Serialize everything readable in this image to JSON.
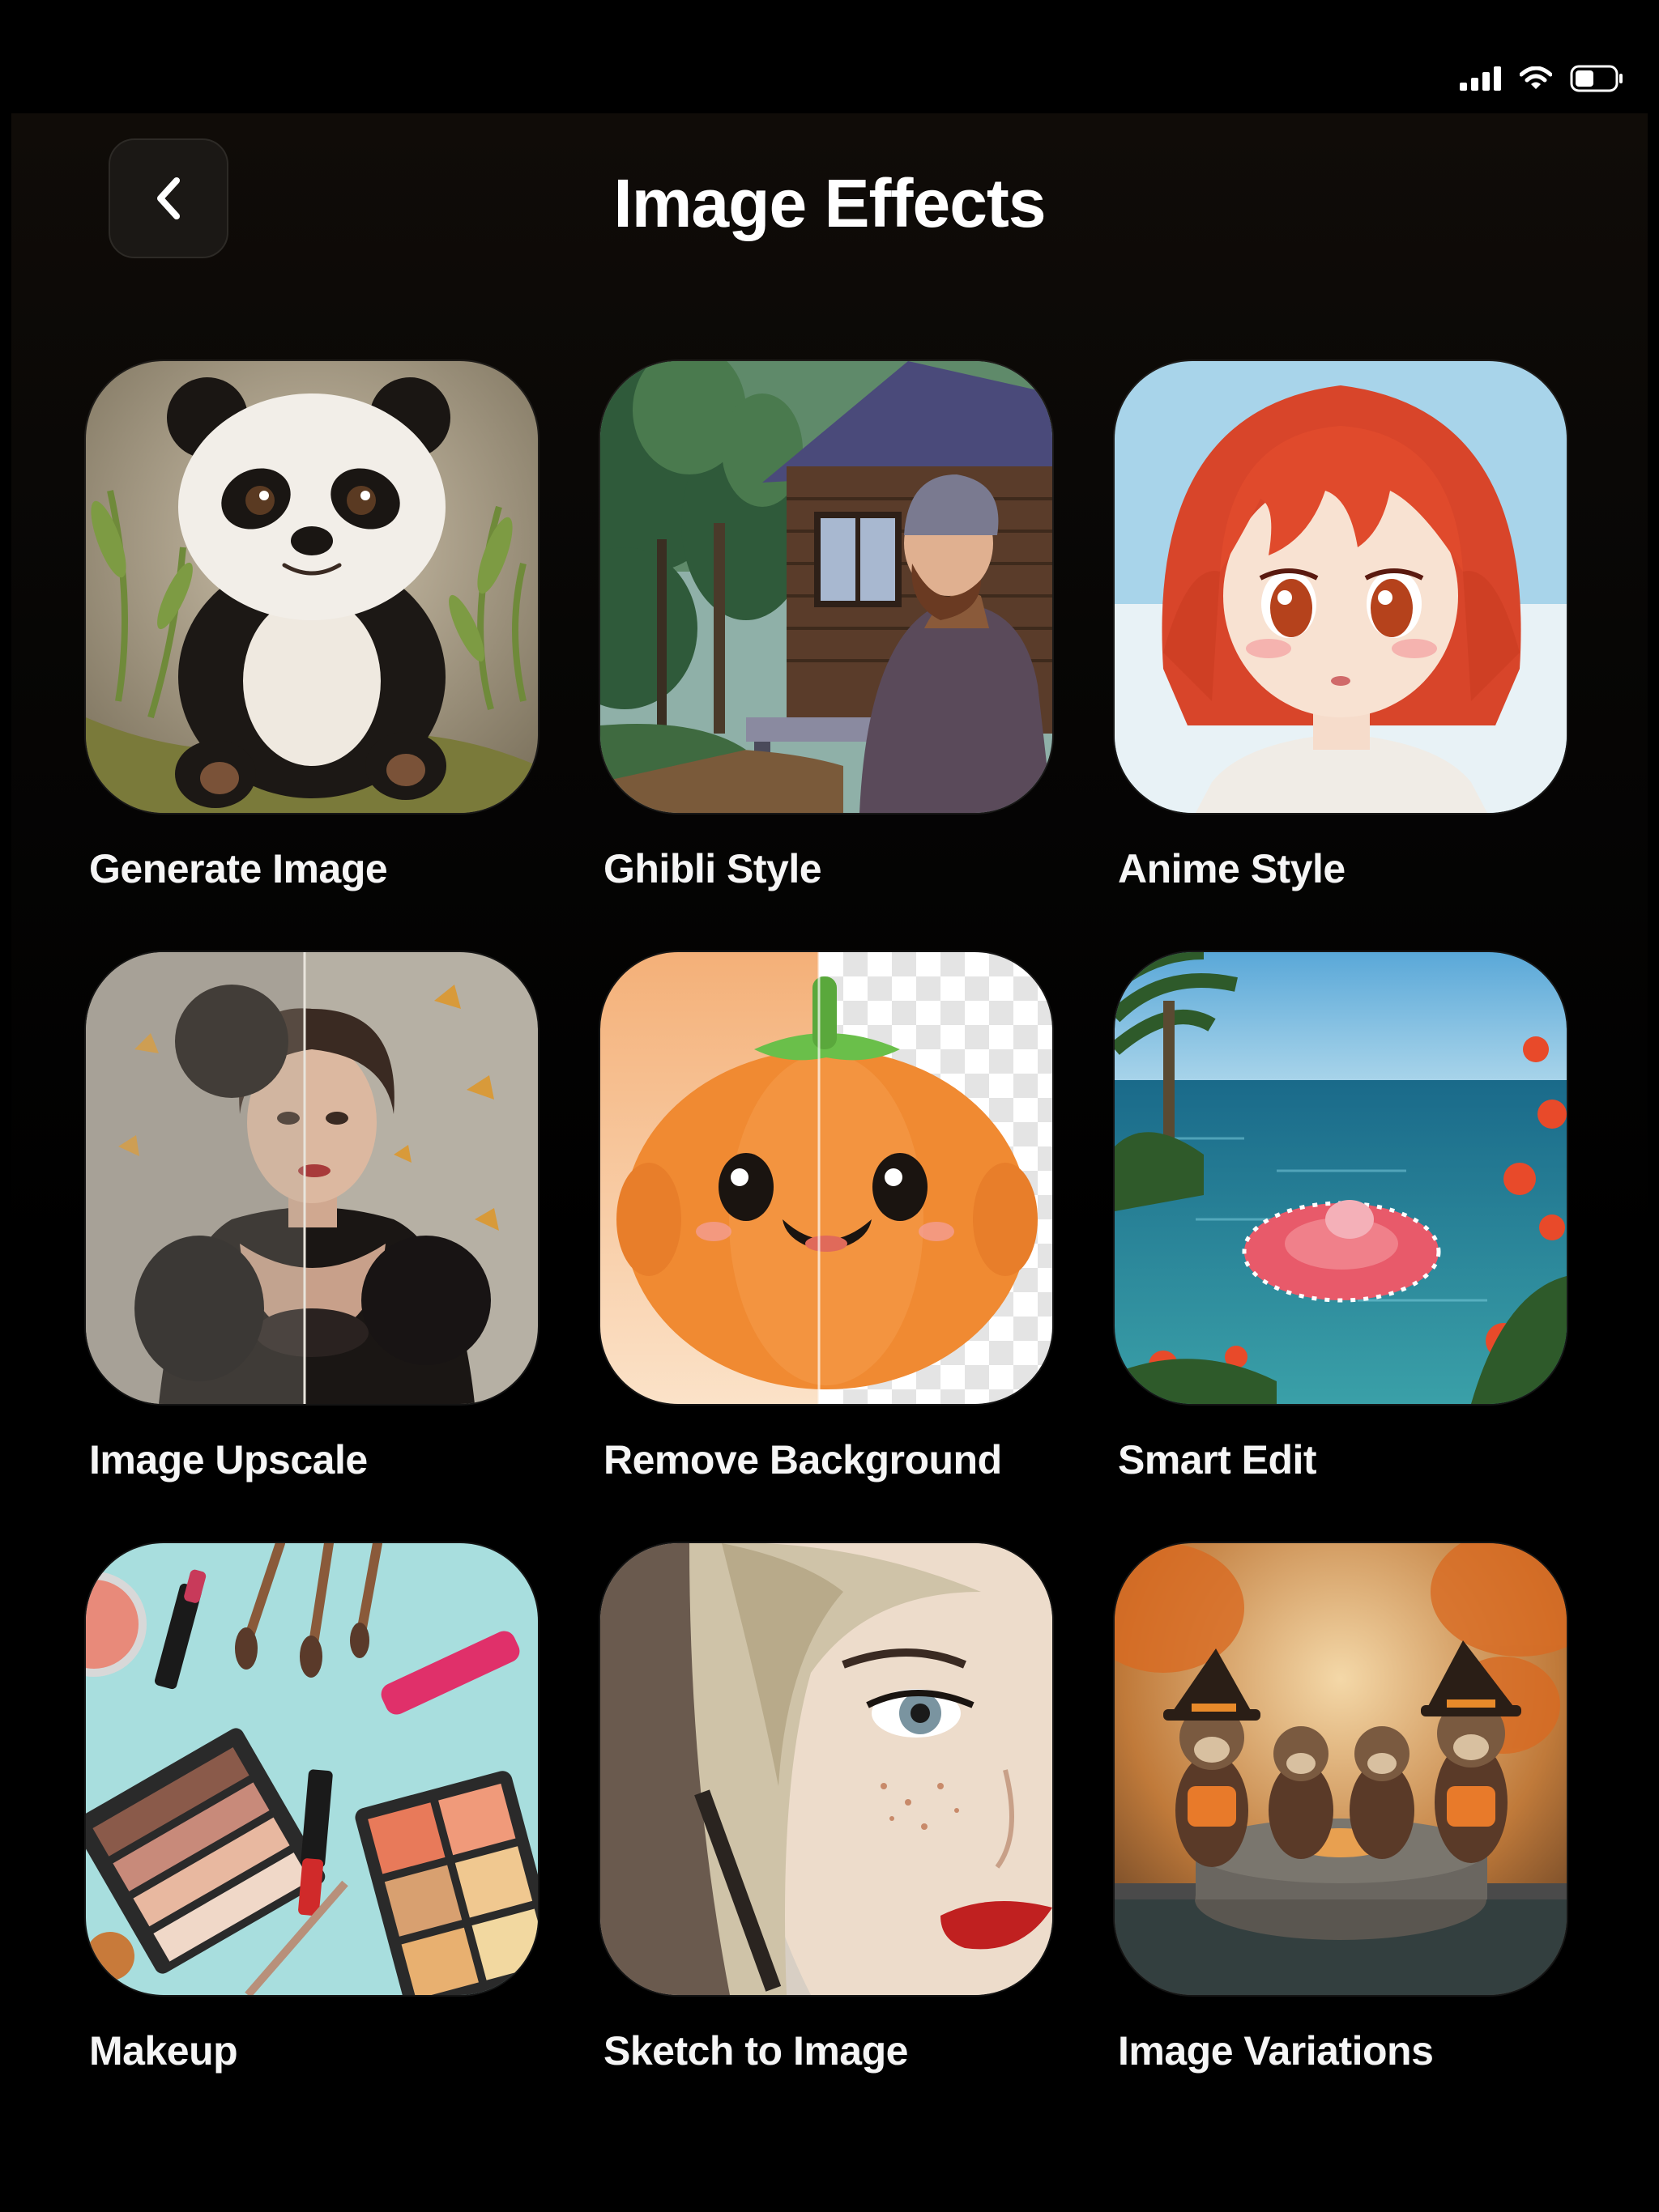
{
  "header": {
    "title": "Image Effects",
    "back_icon": "chevron-left-icon"
  },
  "status_bar": {
    "icons": [
      "signal-icon",
      "wifi-icon",
      "battery-icon"
    ]
  },
  "effects": [
    {
      "label": "Generate Image",
      "thumbnail": "panda-illustration"
    },
    {
      "label": "Ghibli Style",
      "thumbnail": "ghibli-forest-cabin"
    },
    {
      "label": "Anime Style",
      "thumbnail": "anime-girl-red-hair"
    },
    {
      "label": "Image Upscale",
      "thumbnail": "woman-butterflies-before-after"
    },
    {
      "label": "Remove Background",
      "thumbnail": "pumpkin-plush-cutout"
    },
    {
      "label": "Smart Edit",
      "thumbnail": "ocean-float-selection"
    },
    {
      "label": "Makeup",
      "thumbnail": "makeup-flatlay"
    },
    {
      "label": "Sketch to Image",
      "thumbnail": "sketch-woman-face"
    },
    {
      "label": "Image Variations",
      "thumbnail": "otters-witch-hats"
    }
  ],
  "colors": {
    "background": "#000000",
    "text": "#ffffff",
    "button_bg": "#1b1815"
  }
}
